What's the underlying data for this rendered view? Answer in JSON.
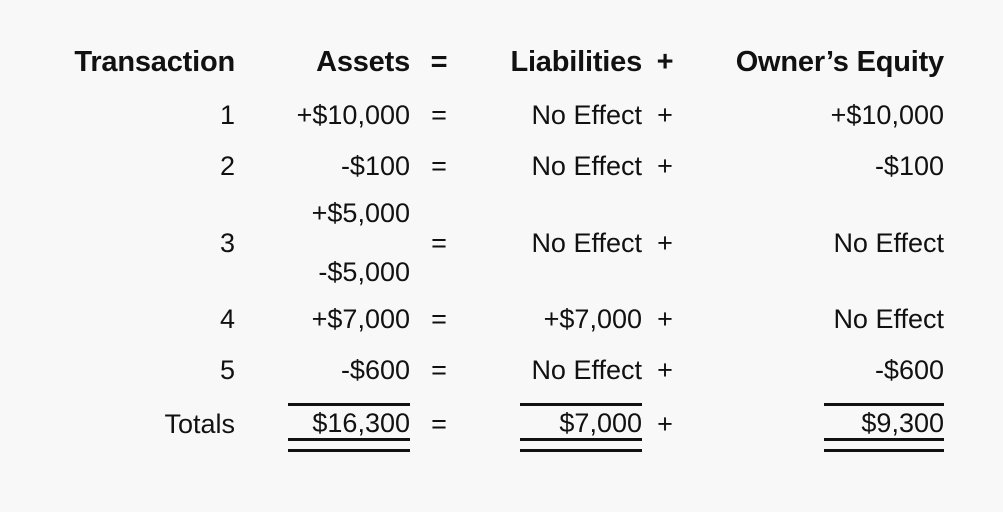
{
  "document": {
    "kind": "accounting-equation-table",
    "background_color": "#f8f8f8",
    "text_color": "#111111"
  },
  "table": {
    "headers": {
      "transaction": "Transaction",
      "assets": "Assets",
      "equals": "=",
      "liabilities": "Liabilities",
      "plus": "+",
      "owners_equity": "Owner’s Equity"
    },
    "operators": {
      "equals": "=",
      "plus": "+"
    },
    "rows": [
      {
        "label": "1",
        "assets": "+$10,000",
        "equals": "=",
        "liabilities": "No Effect",
        "plus": "+",
        "owners_equity": "+$10,000"
      },
      {
        "label": "2",
        "assets": "-$100",
        "equals": "=",
        "liabilities": "No Effect",
        "plus": "+",
        "owners_equity": "-$100"
      },
      {
        "label": "3",
        "assets_top": "+$5,000",
        "assets_bottom": "-$5,000",
        "equals": "=",
        "liabilities": "No Effect",
        "plus": "+",
        "owners_equity": "No Effect"
      },
      {
        "label": "4",
        "assets": "+$7,000",
        "equals": "=",
        "liabilities": "+$7,000",
        "plus": "+",
        "owners_equity": "No Effect"
      },
      {
        "label": "5",
        "assets": "-$600",
        "equals": "=",
        "liabilities": "No Effect",
        "plus": "+",
        "owners_equity": "-$600"
      }
    ],
    "totals": {
      "label": "Totals",
      "assets": "$16,300",
      "equals": "=",
      "liabilities": "$7,000",
      "plus": "+",
      "owners_equity": "$9,300"
    }
  }
}
